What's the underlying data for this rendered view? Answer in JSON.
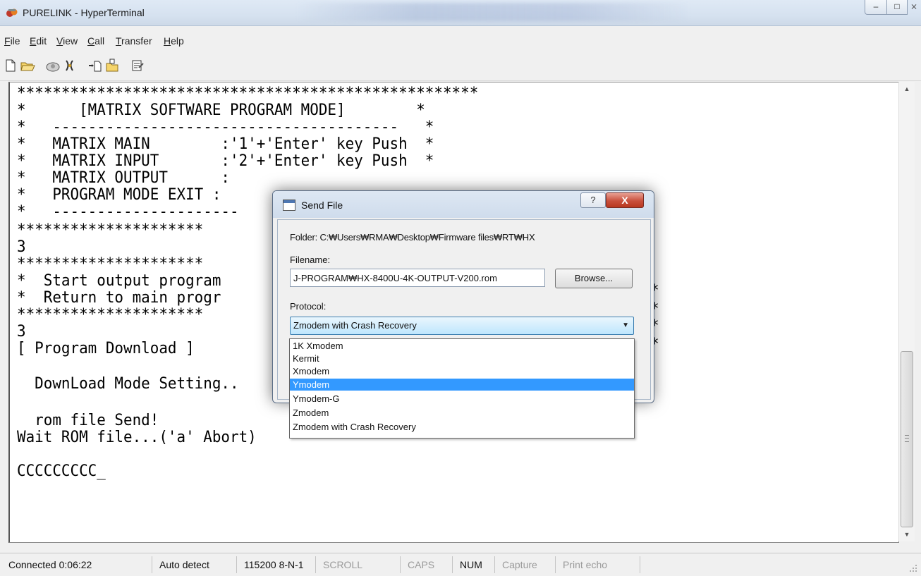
{
  "window": {
    "title": "PURELINK - HyperTerminal",
    "min_glyph": "–",
    "max_glyph": "□",
    "close_glyph": "⨯"
  },
  "menu": {
    "file": {
      "first": "F",
      "rest": "ile"
    },
    "edit": {
      "first": "E",
      "rest": "dit"
    },
    "view": {
      "first": "V",
      "rest": "iew"
    },
    "call": {
      "first": "C",
      "rest": "all"
    },
    "transfer": {
      "first": "T",
      "rest": "ransfer"
    },
    "help": {
      "first": "H",
      "rest": "elp"
    }
  },
  "toolbar": {
    "icons": [
      "new-connection-icon",
      "open-icon",
      "dial-icon",
      "disconnect-icon",
      "send-icon",
      "receive-icon",
      "properties-icon"
    ]
  },
  "terminal": {
    "lines": [
      "****************************************************",
      "*      [MATRIX SOFTWARE PROGRAM MODE]        *",
      "*   ---------------------------------------   *",
      "*   MATRIX MAIN        :'1'+'Enter' key Push  *",
      "*   MATRIX INPUT       :'2'+'Enter' key Push  *",
      "*   MATRIX OUTPUT      :",
      "*   PROGRAM MODE EXIT :",
      "*   ---------------------",
      "*********************",
      "3",
      "*********************",
      "*  Start output program",
      "*  Return to main progr",
      "*********************",
      "3",
      "[ Program Download ]",
      "",
      "  DownLoad Mode Setting..",
      "",
      "  rom file Send!",
      "Wait ROM file...('a' Abort)",
      "",
      "CCCCCCCCC_"
    ],
    "right_stars": [
      "*",
      "*",
      "*",
      "*"
    ]
  },
  "scrollbar": {
    "up_glyph": "▲",
    "down_glyph": "▼"
  },
  "dialog": {
    "title": "Send File",
    "help_glyph": "?",
    "close_glyph": "X",
    "folder_text": "Folder: C:₩Users₩RMA₩Desktop₩Firmware files₩RT₩HX",
    "filename_label": "Filename:",
    "filename_value": "J-PROGRAM₩HX-8400U-4K-OUTPUT-V200.rom",
    "browse_label": "Browse...",
    "protocol_label": "Protocol:",
    "protocol_selected": "Zmodem with Crash Recovery",
    "protocol_arrow": "▼",
    "protocol_options": [
      "1K Xmodem",
      "Kermit",
      "Xmodem",
      "Ymodem",
      "Ymodem-G",
      "Zmodem",
      "Zmodem with Crash Recovery"
    ],
    "highlighted_option": "Ymodem"
  },
  "statusbar": {
    "connected": "Connected 0:06:22",
    "detect": "Auto detect",
    "settings": "115200 8-N-1",
    "scroll": "SCROLL",
    "caps": "CAPS",
    "num": "NUM",
    "capture": "Capture",
    "print_echo": "Print echo"
  },
  "colors": {
    "selection": "#3399ff",
    "close_button": "#c94f3c"
  }
}
